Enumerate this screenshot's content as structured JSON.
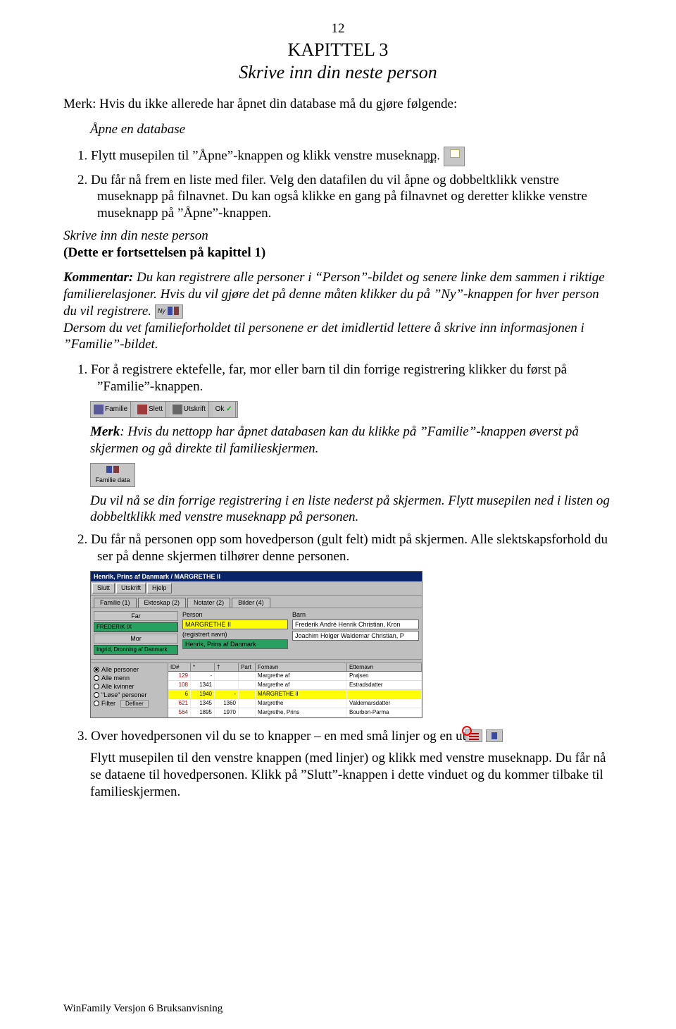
{
  "page_number": "12",
  "chapter_title": "KAPITTEL 3",
  "chapter_subtitle": "Skrive inn din neste person",
  "intro_line": "Merk: Hvis du ikke allerede har åpnet din database må du gjøre følgende:",
  "open_db_line": "Åpne en database",
  "step1_text": "1.  Flytt musepilen til ”Åpne”-knappen og klikk venstre museknapp.",
  "step2_text": "2.  Du får nå frem en liste med filer. Velg den datafilen du vil åpne og dobbeltklikk venstre museknapp på filnavnet. Du kan også klikke en gang på filnavnet og deretter klikke venstre museknapp på ”Åpne”-knappen.",
  "section2_title": "Skrive inn din neste person",
  "section2_sub": "(Dette er fortsettelsen på kapittel 1)",
  "kommentar_label": "Kommentar:",
  "kommentar_body": " Du kan registrere alle personer i “Person”-bildet og senere linke dem sammen i riktige familierelasjoner. Hvis du vil gjøre det på denne måten klikker du på ”Ny”-knappen for hver person du vil registrere.",
  "kommentar_body2": "Dersom du vet familieforholdet til personene er det imidlertid lettere å skrive inn informasjonen i ”Familie”-bildet.",
  "num1_line": "1.  For å registrere ektefelle, far, mor eller barn til din forrige registrering klikker du først på ”Familie”-knappen.",
  "merk_line": "Merk: Hvis du nettopp har åpnet databasen kan du klikke på ”Familie”-knappen øverst på skjermen og gå direkte til familieskjermen.",
  "post_merk_line": "Du vil nå se din forrige registrering i en liste nederst på skjermen. Flytt musepilen ned i listen og dobbeltklikk med venstre museknapp på personen.",
  "num2_line": "2.  Du får nå personen opp som hovedperson (gult felt) midt på skjermen. Alle slektskapsforhold du ser på denne skjermen tilhører denne personen.",
  "num3_line_a": "3.  Over hovedpersonen vil du se to knapper – en med små linjer og en uten.",
  "num3_line_b": "Flytt musepilen til den venstre knappen (med linjer) og klikk med venstre museknapp. Du får nå se dataene til hovedpersonen. Klikk på ”Slutt”-knappen i dette vinduet og du kommer tilbake til familieskjermen.",
  "footer_text": "WinFamily Versjon 6 Bruksanvisning",
  "hent_label": "Hent",
  "ny_label": "Ny",
  "famdata_label": "Familie data",
  "toolbar": {
    "familie": "Familie",
    "slett": "Slett",
    "utskrift": "Utskrift",
    "ok": "Ok"
  },
  "app": {
    "title": "Henrik, Prins af Danmark / MARGRETHE II",
    "tb": {
      "slutt": "Slutt",
      "utskrift": "Utskrift",
      "hjelp": "Hjelp"
    },
    "tabs": {
      "familie": "Familie (1)",
      "ekteskap": "Ekteskap (2)",
      "notater": "Notater (2)",
      "bilder": "Bilder (4)"
    },
    "left": {
      "far": "Far",
      "mor": "Mor",
      "far_name": "FREDERIK IX",
      "mor_name": "Ingrid, Dronning af Danmark"
    },
    "person_hdr": "Person",
    "main_name": "MARGRETHE II",
    "registrert": "(registrert navn)",
    "reg_val": "Henrik, Prins af Danmark",
    "barn_hdr": "Barn",
    "barn1": "Frederik André Henrik Christian, Kron",
    "barn2": "Joachim Holger Waldemar Christian, P",
    "radios": {
      "r1": "Alle personer",
      "r2": "Alle menn",
      "r3": "Alle kvinner",
      "r4": "\"Løse\" personer",
      "r5": "Filter",
      "def": "Definer"
    },
    "grid_headers": {
      "id": "ID#",
      "c1": "*",
      "c2": "†",
      "p": "Part",
      "fornavn": "Fornavn",
      "etternavn": "Etternavn"
    },
    "grid_rows": [
      {
        "id": "129",
        "c1": "-",
        "c2": "",
        "p": "",
        "fn": "Margrethe af",
        "en": "Prøjsen"
      },
      {
        "id": "108",
        "c1": "1341",
        "c2": "",
        "p": "",
        "fn": "Margrethe af",
        "en": "Estradsdatter"
      },
      {
        "id": "6",
        "c1": "1940",
        "c2": "-",
        "p": "",
        "fn": "MARGRETHE II",
        "en": ""
      },
      {
        "id": "621",
        "c1": "1345",
        "c2": "1360",
        "p": "",
        "fn": "Margrethe",
        "en": "Valdemarsdatter"
      },
      {
        "id": "564",
        "c1": "1895",
        "c2": "1970",
        "p": "",
        "fn": "Margrethe, Prins",
        "en": "Bourbon-Parma"
      }
    ]
  }
}
